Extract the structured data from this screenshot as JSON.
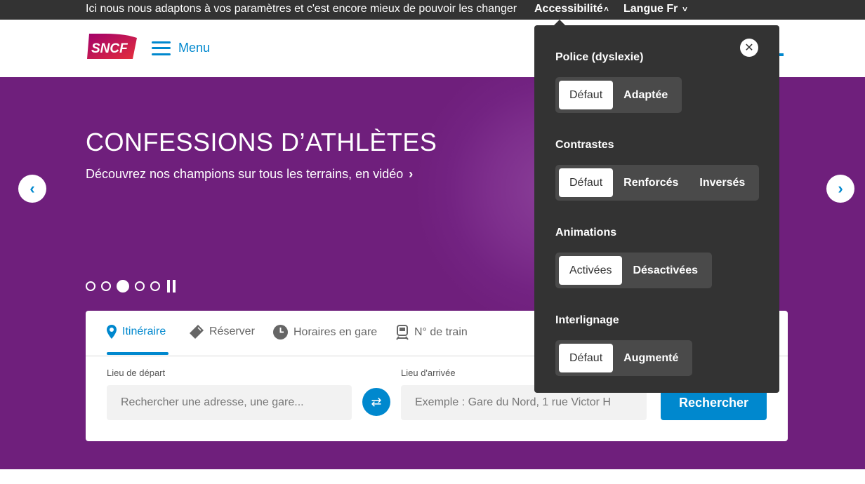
{
  "topbar": {
    "message": "Ici nous nous adaptons à vos paramètres et c'est encore mieux de pouvoir les changer",
    "accessibility_label": "Accessibilité",
    "language_label": "Langue Fr"
  },
  "header": {
    "logo_text": "SNCF",
    "menu_label": "Menu"
  },
  "hero": {
    "title": "CONFESSIONS D’ATHLÈTES",
    "subtitle": "Découvrez nos champions sur tous les terrains, en vidéo",
    "slide_count": 5,
    "active_slide": 3
  },
  "search": {
    "tabs": [
      {
        "label": "Itinéraire",
        "icon": "location-pin-icon",
        "active": true
      },
      {
        "label": "Réserver",
        "icon": "ticket-icon",
        "active": false
      },
      {
        "label": "Horaires en gare",
        "icon": "clock-icon",
        "active": false
      },
      {
        "label": "N° de train",
        "icon": "train-icon",
        "active": false
      }
    ],
    "departure_label": "Lieu de départ",
    "departure_placeholder": "Rechercher une adresse, une gare...",
    "arrival_label": "Lieu d'arrivée",
    "arrival_placeholder": "Exemple : Gare du Nord, 1 rue Victor H",
    "submit_label": "Rechercher"
  },
  "accessibility_panel": {
    "groups": [
      {
        "label": "Police (dyslexie)",
        "options": [
          "Défaut",
          "Adaptée"
        ],
        "selected": "Défaut"
      },
      {
        "label": "Contrastes",
        "options": [
          "Défaut",
          "Renforcés",
          "Inversés"
        ],
        "selected": "Défaut"
      },
      {
        "label": "Animations",
        "options": [
          "Activées",
          "Désactivées"
        ],
        "selected": "Activées"
      },
      {
        "label": "Interlignage",
        "options": [
          "Défaut",
          "Augmenté"
        ],
        "selected": "Défaut"
      }
    ]
  },
  "colors": {
    "brand_blue": "#0088ce",
    "hero_purple": "#6f1f7c",
    "panel_dark": "#333333"
  }
}
